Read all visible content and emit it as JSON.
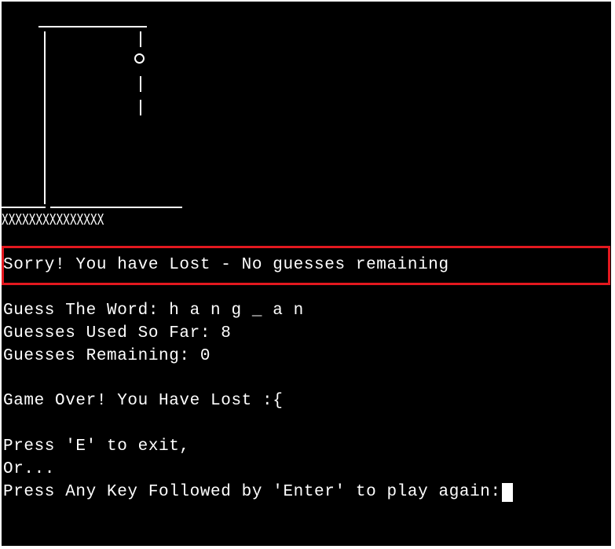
{
  "colors": {
    "background": "#000000",
    "foreground": "#ffffff",
    "highlight_border": "#e3181f"
  },
  "hangman": {
    "base": "XXXXXXXXXXXXXXX"
  },
  "lost_banner": "Sorry! You have Lost - No guesses remaining",
  "status": {
    "word_line": "Guess The Word: h a n g _ a n",
    "used_line": "Guesses Used So Far: 8",
    "remaining_line": "Guesses Remaining: 0"
  },
  "game_over": "Game Over! You Have Lost :{",
  "prompt": {
    "exit_line": "Press 'E' to exit,",
    "or_line": "Or...",
    "again_line": "Press Any Key Followed by 'Enter' to play again:"
  }
}
